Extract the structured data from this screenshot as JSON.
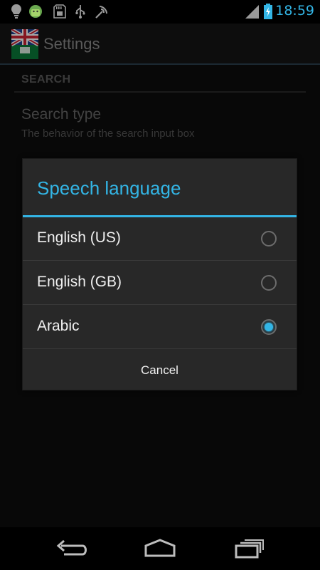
{
  "statusbar": {
    "time": "18:59",
    "icons": [
      "lightbulb-icon",
      "android-icon",
      "sd-card-icon",
      "usb-icon",
      "satellite-icon",
      "signal-icon",
      "battery-charging-icon"
    ]
  },
  "actionbar": {
    "title": "Settings"
  },
  "settings": {
    "section_header": "SEARCH",
    "pref_title": "Search type",
    "pref_summary": "The behavior of the search input box"
  },
  "dialog": {
    "title": "Speech language",
    "options": [
      {
        "label": "English (US)",
        "checked": false
      },
      {
        "label": "English (GB)",
        "checked": false
      },
      {
        "label": "Arabic",
        "checked": true
      }
    ],
    "cancel_label": "Cancel"
  },
  "colors": {
    "accent": "#33b5e5"
  }
}
